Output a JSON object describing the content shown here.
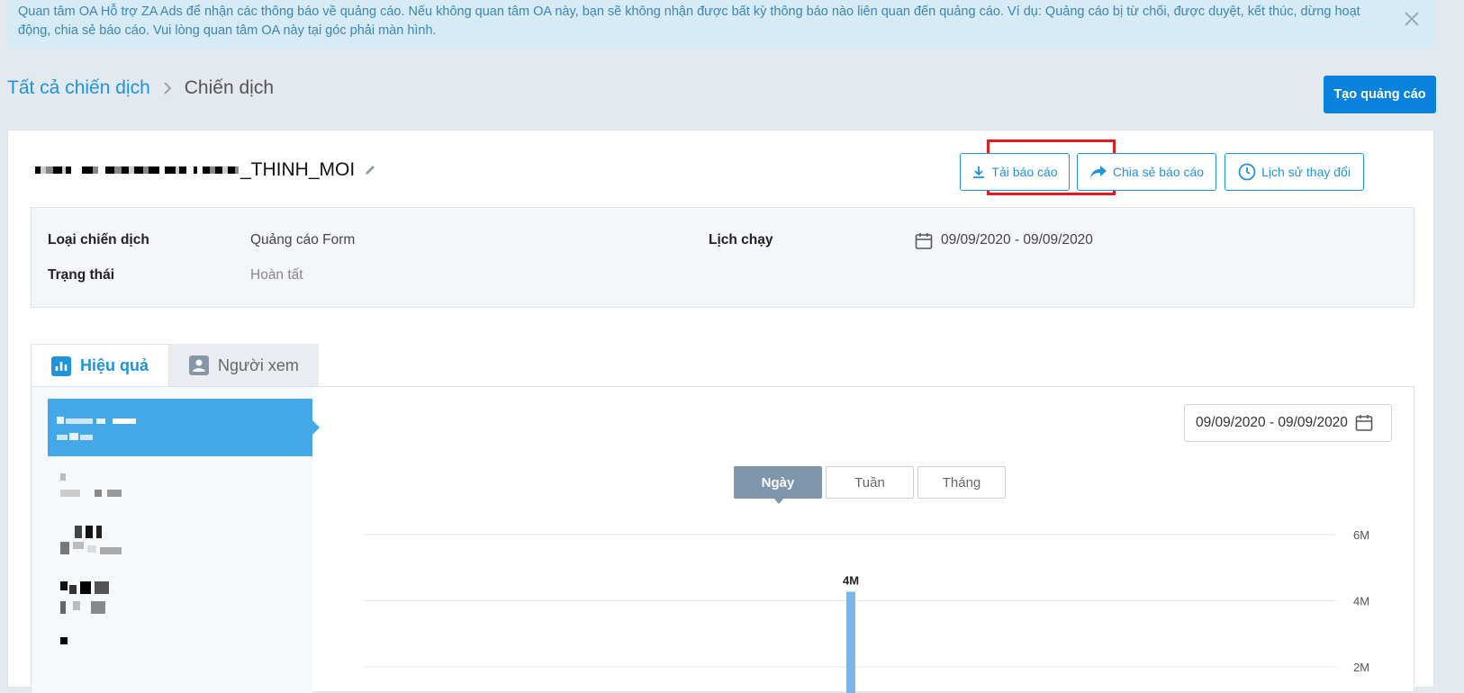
{
  "notice": {
    "text": "Quan tâm OA Hỗ trợ ZA Ads để nhận các thông báo về quảng cáo. Nếu không quan tâm OA này, bạn sẽ không nhận được bất kỳ thông báo nào liên quan đến quảng cáo. Ví dụ: Quảng cáo bị từ chối, được duyệt, kết thúc, dừng hoạt động, chia sẻ báo cáo. Vui lòng quan tâm OA này tại góc phải màn hình."
  },
  "breadcrumb": {
    "root": "Tất cả chiến dịch",
    "current": "Chiến dịch"
  },
  "create_button": "Tạo quảng cáo",
  "campaign": {
    "name_suffix": "_THINH_MOI",
    "actions": {
      "download": "Tải báo cáo",
      "share": "Chia sẻ báo cáo",
      "history": "Lịch sử thay đổi"
    }
  },
  "info": {
    "type_label": "Loại chiến dịch",
    "type_value": "Quảng cáo Form",
    "status_label": "Trạng thái",
    "status_value": "Hoàn tất",
    "schedule_label": "Lịch chạy",
    "schedule_value": "09/09/2020 - 09/09/2020"
  },
  "tabs": [
    {
      "label": "Hiệu quả",
      "icon": "bar-chart-icon",
      "active": true
    },
    {
      "label": "Người xem",
      "icon": "users-icon",
      "active": false
    }
  ],
  "date_range": "09/09/2020 - 09/09/2020",
  "granularity": [
    {
      "label": "Ngày",
      "active": true
    },
    {
      "label": "Tuần",
      "active": false
    },
    {
      "label": "Tháng",
      "active": false
    }
  ],
  "colors": {
    "accent": "#1f93dc",
    "primary_button": "#0a82dd",
    "highlight": "#e21b22",
    "bar": "#7ab6ea"
  },
  "chart_data": {
    "type": "bar",
    "y_ticks": [
      "6M",
      "4M",
      "2M"
    ],
    "ylim": [
      0,
      6000000
    ],
    "points": [
      {
        "label": "4M",
        "value": 4000000
      }
    ]
  }
}
